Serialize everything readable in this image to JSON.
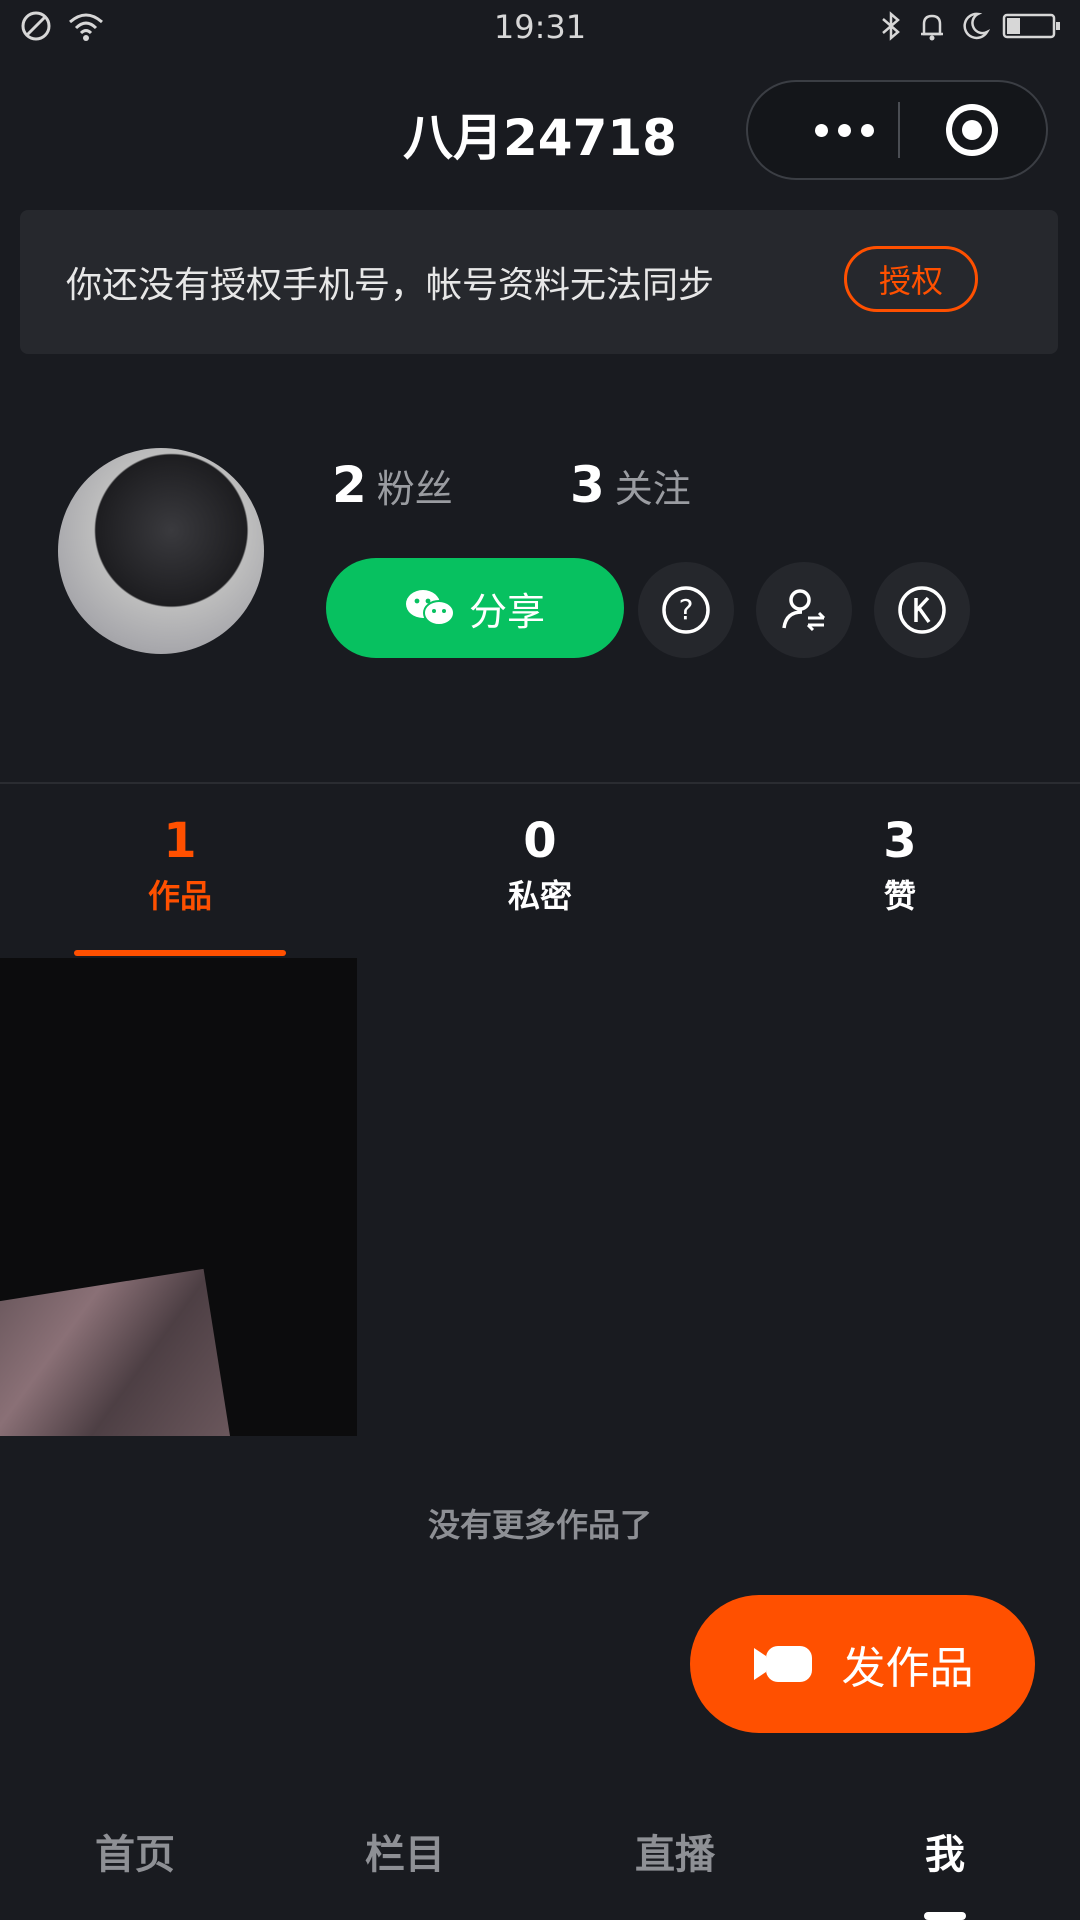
{
  "status_bar": {
    "time": "19:31"
  },
  "header": {
    "title": "八月24718"
  },
  "auth_banner": {
    "text": "你还没有授权手机号，帐号资料无法同步",
    "button": "授权"
  },
  "profile": {
    "followers_count": "2",
    "followers_label": "粉丝",
    "following_count": "3",
    "following_label": "关注",
    "share_label": "分享"
  },
  "tabs": [
    {
      "count": "1",
      "label": "作品"
    },
    {
      "count": "0",
      "label": "私密"
    },
    {
      "count": "3",
      "label": "赞"
    }
  ],
  "no_more_text": "没有更多作品了",
  "post_button": "发作品",
  "nav": [
    {
      "label": "首页"
    },
    {
      "label": "栏目"
    },
    {
      "label": "直播"
    },
    {
      "label": "我"
    }
  ],
  "colors": {
    "accent": "#ff5000",
    "share_green": "#07c160",
    "background": "#191b20"
  }
}
